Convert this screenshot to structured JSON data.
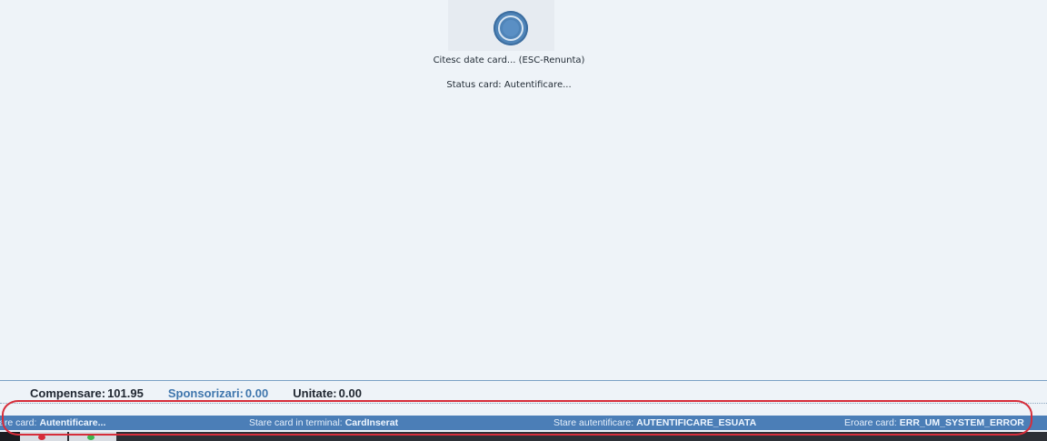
{
  "loading": {
    "spinner_icon": "loading-spinner-icon",
    "message": "Citesc date card... (ESC-Renunta)",
    "status": "Status card: Autentificare..."
  },
  "summary": {
    "compensare_label": "Compensare:",
    "compensare_value": "101.95",
    "sponsorizari_label": "Sponsorizari:",
    "sponsorizari_value": "0.00",
    "unitate_label": "Unitate:",
    "unitate_value": "0.00"
  },
  "status_bar": {
    "stare_card_label": "are card:",
    "stare_card_value": "Autentificare...",
    "terminal_label": "Stare card in terminal:",
    "terminal_value": "CardInserat",
    "autentificare_label": "Stare autentificare:",
    "autentificare_value": "AUTENTIFICARE_ESUATA",
    "eroare_label": "Eroare card:",
    "eroare_value": "ERR_UM_SYSTEM_ERROR"
  },
  "colors": {
    "status_bar": "#4b7eb7",
    "sponsor_text": "#3f76ad",
    "highlight": "#d62d3a"
  },
  "taskbar": {
    "red_icon": "red-circle-icon",
    "green_icon": "green-circle-icon"
  }
}
